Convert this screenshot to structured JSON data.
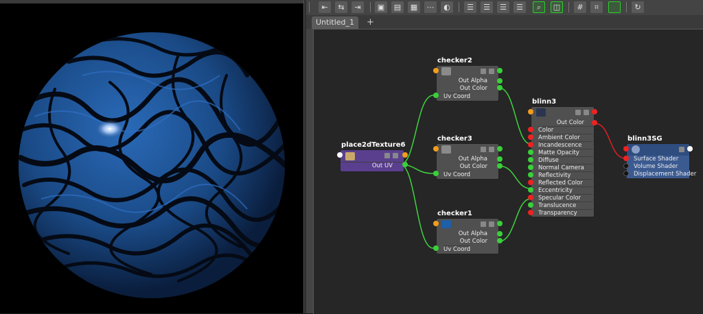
{
  "editor": {
    "tab_label": "Untitled_1",
    "add_tab_label": "+"
  },
  "nodes": {
    "place2d": {
      "title": "place2dTexture6",
      "out_uv": "Out UV"
    },
    "checker2": {
      "title": "checker2",
      "out_alpha": "Out Alpha",
      "out_color": "Out Color",
      "uv_coord": "Uv Coord"
    },
    "checker3": {
      "title": "checker3",
      "out_alpha": "Out Alpha",
      "out_color": "Out Color",
      "uv_coord": "Uv Coord"
    },
    "checker1": {
      "title": "checker1",
      "out_alpha": "Out Alpha",
      "out_color": "Out Color",
      "uv_coord": "Uv Coord"
    },
    "blinn3": {
      "title": "blinn3",
      "out_color": "Out Color",
      "attrs": [
        "Color",
        "Ambient Color",
        "Incandescence",
        "Matte Opacity",
        "Diffuse",
        "Normal Camera",
        "Reflectivity",
        "Reflected Color",
        "Eccentricity",
        "Specular Color",
        "Translucence",
        "Transparency"
      ]
    },
    "blinn3sg": {
      "title": "blinn3SG",
      "attrs": [
        "Surface Shader",
        "Volume Shader",
        "Displacement Shader"
      ]
    }
  },
  "colors": {
    "wire_green": "#3fd43f",
    "wire_red": "#e02020",
    "node_purple": "#5a3f8e",
    "node_blue": "#2f4d7e",
    "sphere_blue": "#1e4f8c"
  },
  "viewport": {
    "content": "blue-patterned-sphere-render"
  }
}
